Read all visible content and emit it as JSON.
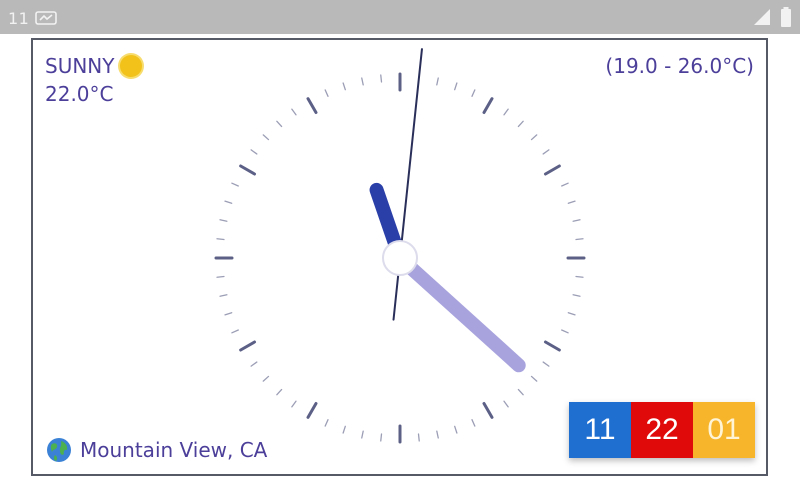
{
  "status_bar": {
    "time": "11",
    "left_icons": [
      "notification-icon"
    ],
    "right_icons": [
      "signal-icon",
      "battery-icon"
    ]
  },
  "weather": {
    "condition": "SUNNY",
    "condition_icon": "sun-icon",
    "temperature": "22.0°C",
    "range": "(19.0 - 26.0°C)"
  },
  "location": {
    "icon": "globe-icon",
    "name": "Mountain View, CA"
  },
  "clock": {
    "hours": 11,
    "minutes": 22,
    "seconds": 1
  },
  "digital_time": {
    "hours": "11",
    "minutes": "22",
    "seconds": "01"
  },
  "colors": {
    "text": "#4b3f9a",
    "hour_hand": "#2b3fa8",
    "minute_hand": "#9a94d8",
    "second_hand": "#2a2f5a",
    "tick": "#4b4f7a",
    "hour_box": "#1f6fd1",
    "minute_box": "#e00a0a",
    "second_box": "#f6b52a"
  }
}
